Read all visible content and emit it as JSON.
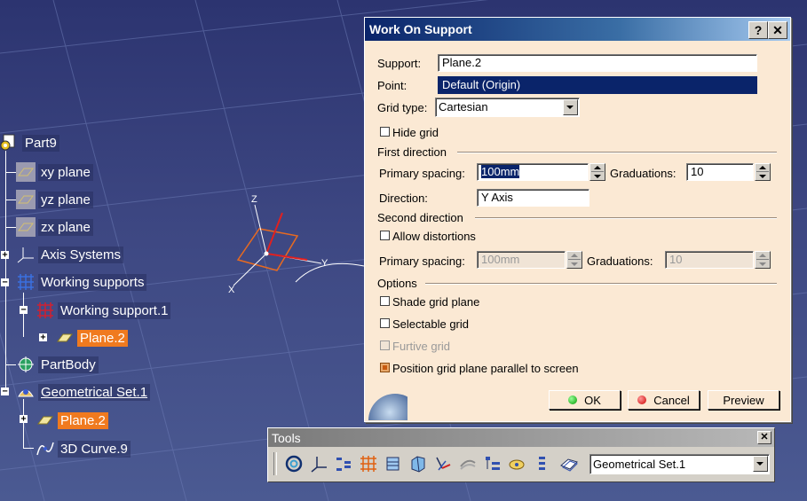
{
  "viewport": {
    "axis_labels": {
      "z": "Z",
      "x": "X",
      "y": "Y"
    }
  },
  "spec_tree": {
    "items": [
      {
        "label": "Part9",
        "icon": "part-icon",
        "selected": false
      },
      {
        "label": "xy plane",
        "icon": "plane-icon"
      },
      {
        "label": "yz plane",
        "icon": "plane-icon"
      },
      {
        "label": "zx plane",
        "icon": "plane-icon"
      },
      {
        "label": "Axis Systems",
        "icon": "axis-system-icon"
      },
      {
        "label": "Working supports",
        "icon": "working-supports-icon"
      },
      {
        "label": "Working support.1",
        "icon": "working-support-icon"
      },
      {
        "label": "Plane.2",
        "icon": "plane-icon",
        "selected": true
      },
      {
        "label": "PartBody",
        "icon": "partbody-icon"
      },
      {
        "label": "Geometrical Set.1",
        "icon": "geometrical-set-icon",
        "underlined": true
      },
      {
        "label": "Plane.2",
        "icon": "plane-icon",
        "selected": true
      },
      {
        "label": "3D Curve.9",
        "icon": "curve-icon"
      }
    ]
  },
  "dialog": {
    "title": "Work On Support",
    "help_label": "?",
    "close_label": "✕",
    "support_label": "Support:",
    "support_value": "Plane.2",
    "point_label": "Point:",
    "point_value": "Default (Origin)",
    "grid_type_label": "Grid type:",
    "grid_type_value": "Cartesian",
    "hide_grid_label": "Hide grid",
    "hide_grid_checked": false,
    "first_direction": {
      "title": "First direction",
      "primary_spacing_label": "Primary spacing:",
      "primary_spacing_value": "100mm",
      "graduations_label": "Graduations:",
      "graduations_value": "10",
      "direction_label": "Direction:",
      "direction_value": "Y Axis"
    },
    "second_direction": {
      "title": "Second direction",
      "allow_distortions_label": "Allow distortions",
      "allow_distortions_checked": false,
      "primary_spacing_label": "Primary spacing:",
      "primary_spacing_value": "100mm",
      "graduations_label": "Graduations:",
      "graduations_value": "10"
    },
    "options": {
      "title": "Options",
      "shade_grid_plane_label": "Shade grid plane",
      "selectable_grid_label": "Selectable grid",
      "furtive_grid_label": "Furtive grid",
      "position_parallel_label": "Position grid plane parallel to screen",
      "position_parallel_checked": true
    },
    "ok_label": "OK",
    "cancel_label": "Cancel",
    "preview_label": "Preview"
  },
  "toolbar": {
    "title": "Tools",
    "close_label": "✕",
    "icons": [
      "update-icon",
      "axis-system-icon",
      "tree-explode-icon",
      "grid-icon",
      "work-on-support-icon",
      "3d-support-icon",
      "snap-icon",
      "hide-icon",
      "spec-tree-icon",
      "visibility-icon",
      "stack-icon",
      "plane-system-icon"
    ],
    "current_set": "Geometrical Set.1"
  },
  "colors": {
    "selection_orange": "#f07a1f",
    "dialog_bg": "#fbe9d4",
    "title_blue": "#0a246a"
  }
}
